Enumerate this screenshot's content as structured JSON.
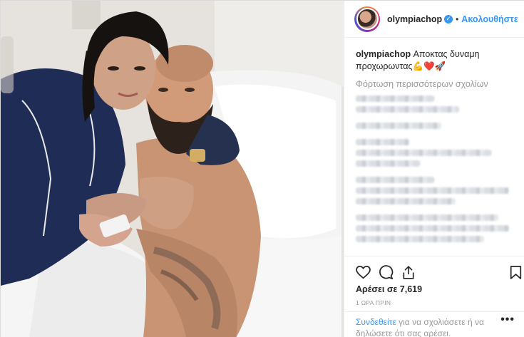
{
  "post": {
    "author": "olympiachop",
    "follow_label": "Ακολουθήστε",
    "separator": "•",
    "verified_mark": "✓",
    "caption_text": "Αποκτας δυναμη προχωρωντας💪❤️🚀",
    "load_more": "Φόρτωση περισσότερων σχολίων",
    "likes": "Αρέσει σε 7,619",
    "time": "1 ΩΡΑ ΠΡΙΝ",
    "login_link": "Συνδεθείτε",
    "login_suffix": " για να σχολιάσετε ή να δηλώσετε ότι σας αρέσει.",
    "more_label": "•••"
  },
  "icons": {
    "like": "heart-icon",
    "comment": "comment-bubble-icon",
    "share": "share-icon",
    "save": "bookmark-icon"
  },
  "colors": {
    "link": "#3897f0",
    "text": "#262626",
    "muted": "#999999",
    "border": "#efefef"
  }
}
